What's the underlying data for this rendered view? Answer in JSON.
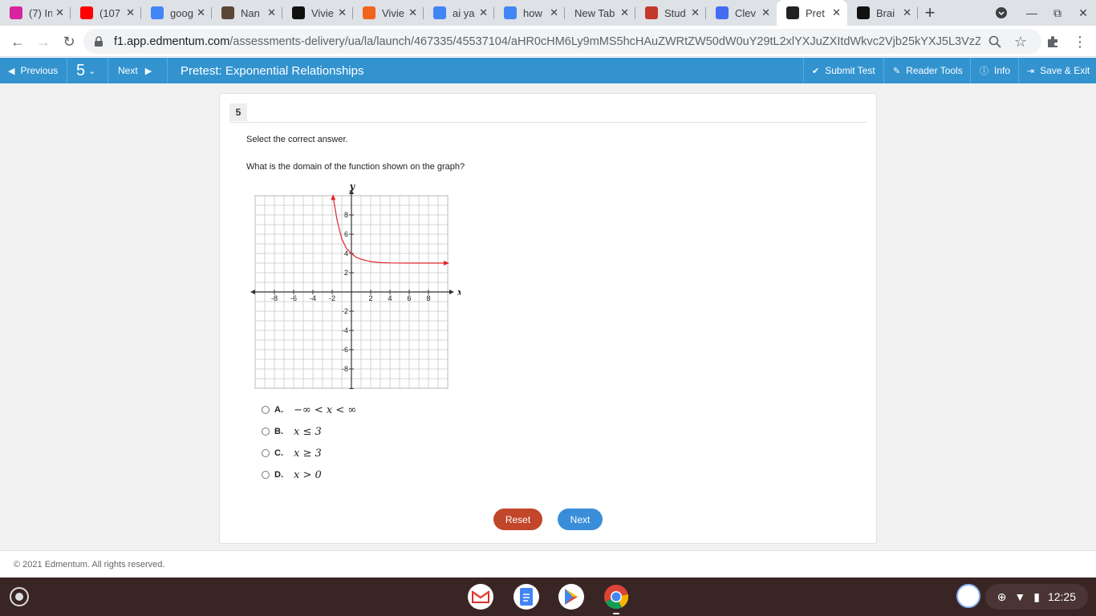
{
  "browser": {
    "tabs": [
      {
        "title": "(7) In",
        "favicon": "instagram-icon",
        "color": "#d6249f"
      },
      {
        "title": "(107",
        "favicon": "youtube-icon",
        "color": "#ff0000"
      },
      {
        "title": "goog",
        "favicon": "google-icon",
        "color": "#4285f4"
      },
      {
        "title": "Nan",
        "favicon": "avatar-icon",
        "color": "#5b4636"
      },
      {
        "title": "Vivie",
        "favicon": "y-logo-icon",
        "color": "#111111"
      },
      {
        "title": "Vivie",
        "favicon": "etsy-icon",
        "color": "#f1641e"
      },
      {
        "title": "ai ya",
        "favicon": "google-icon",
        "color": "#4285f4"
      },
      {
        "title": "how",
        "favicon": "google-icon",
        "color": "#4285f4"
      },
      {
        "title": "New Tab",
        "favicon": "",
        "color": ""
      },
      {
        "title": "Stud",
        "favicon": "studyisland-icon",
        "color": "#c0392b"
      },
      {
        "title": "Clev",
        "favicon": "clever-icon",
        "color": "#436cf2"
      },
      {
        "title": "Pret",
        "favicon": "edmentum-icon",
        "color": "#222222",
        "active": true
      },
      {
        "title": "Brai",
        "favicon": "brainly-icon",
        "color": "#111111"
      }
    ],
    "url_host": "f1.app.edmentum.com",
    "url_path": "/assessments-delivery/ua/la/launch/467335/45537104/aHR0cHM6Ly9mMS5hcHAuZWRtZW50dW0uY29tL2xlYXJuZXItdWkvc2Vjb25kYXJ5L3VzZ..."
  },
  "appbar": {
    "previous": "Previous",
    "question_number": "5",
    "next": "Next",
    "title": "Pretest: Exponential Relationships",
    "submit": "Submit Test",
    "reader_tools": "Reader Tools",
    "info": "Info",
    "save_exit": "Save & Exit",
    "color": "#3293cf"
  },
  "question": {
    "number": "5",
    "instruction": "Select the correct answer.",
    "prompt": "What is the domain of the function shown on the graph?",
    "choices": [
      {
        "letter": "A.",
        "text": "−∞ < x < ∞"
      },
      {
        "letter": "B.",
        "text": "x ≤ 3"
      },
      {
        "letter": "C.",
        "text": "x ≥ 3"
      },
      {
        "letter": "D.",
        "text": "x > 0"
      }
    ],
    "reset_label": "Reset",
    "next_label": "Next"
  },
  "chart_data": {
    "type": "line",
    "title": "",
    "xlabel": "x",
    "ylabel": "y",
    "xlim": [
      -10,
      10
    ],
    "ylim": [
      -10,
      10
    ],
    "x_ticks": [
      "-8",
      "-6",
      "-4",
      "-2",
      "2",
      "4",
      "6",
      "8"
    ],
    "y_ticks": [
      "8",
      "6",
      "4",
      "2",
      "-2",
      "-4",
      "-6",
      "-8"
    ],
    "grid": true,
    "series": [
      {
        "color": "#e0252b",
        "x": [
          -1.9,
          -1.5,
          -1,
          -0.5,
          0,
          0.5,
          1,
          2,
          3,
          4,
          6,
          8,
          10
        ],
        "y": [
          9.9,
          7.5,
          5.5,
          4.5,
          4.0,
          3.6,
          3.4,
          3.15,
          3.05,
          3.02,
          3.0,
          3.0,
          3.0
        ]
      }
    ]
  },
  "footer": {
    "copyright": "© 2021 Edmentum. All rights reserved."
  },
  "shelf": {
    "time": "12:25",
    "apps": [
      "gmail-icon",
      "docs-icon",
      "play-store-icon",
      "chrome-icon"
    ]
  }
}
